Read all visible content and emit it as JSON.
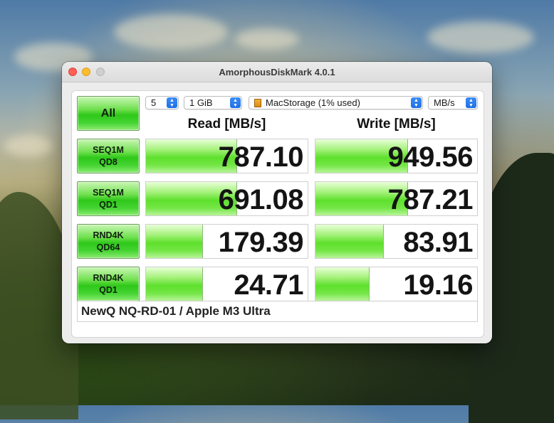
{
  "window": {
    "title": "AmorphousDiskMark 4.0.1"
  },
  "toolbar": {
    "all_label": "All",
    "count_select": "5",
    "size_select": "1 GiB",
    "target_select": "MacStorage (1% used)",
    "unit_select": "MB/s"
  },
  "headers": {
    "read": "Read [MB/s]",
    "write": "Write [MB/s]"
  },
  "tests": [
    {
      "line1": "SEQ1M",
      "line2": "QD8",
      "read": "787.10",
      "write": "949.56",
      "read_fill": 0.56,
      "write_fill": 0.57
    },
    {
      "line1": "SEQ1M",
      "line2": "QD1",
      "read": "691.08",
      "write": "787.21",
      "read_fill": 0.56,
      "write_fill": 0.57
    },
    {
      "line1": "RND4K",
      "line2": "QD64",
      "read": "179.39",
      "write": "83.91",
      "read_fill": 0.35,
      "write_fill": 0.42
    },
    {
      "line1": "RND4K",
      "line2": "QD1",
      "read": "24.71",
      "write": "19.16",
      "read_fill": 0.35,
      "write_fill": 0.33
    }
  ],
  "comment": "NewQ NQ-RD-01 / Apple M3 Ultra",
  "colors": {
    "accent_green": "#4fd628",
    "select_blue": "#2a7cf0"
  }
}
